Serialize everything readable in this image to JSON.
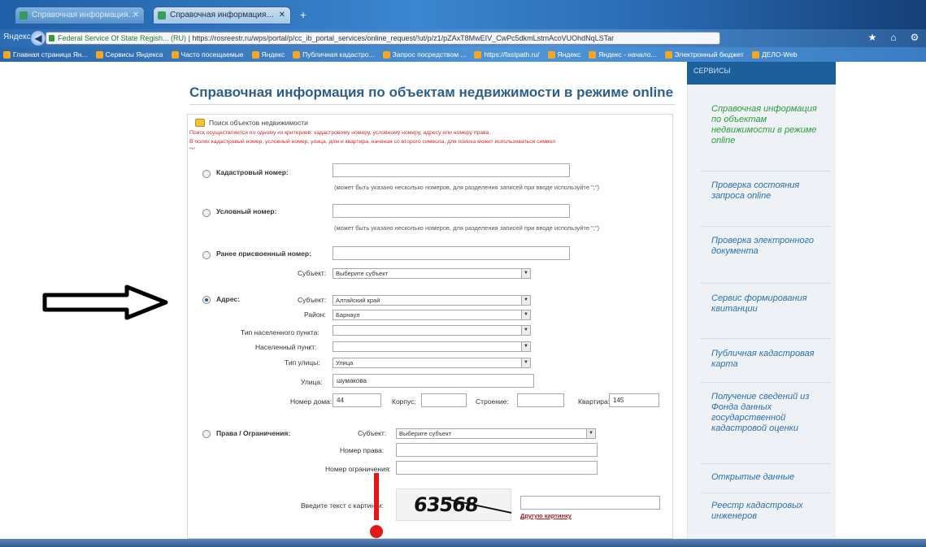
{
  "browser": {
    "tabs": [
      {
        "label": "Справочная информация…"
      },
      {
        "label": "Справочная информация…"
      }
    ],
    "new_tab": "+",
    "search_label": "Яндекс",
    "url_org": "Federal Service Of State Regish... (RU)",
    "url": "https://rosreestr.ru/wps/portal/p/cc_ib_portal_services/online_request/!ut/p/z1/pZAxT8MwEIV_CwPc5dkmLstmAcoVUOhdNqLSTar",
    "toolbar_icons": [
      "★",
      "⌂",
      "⚙"
    ],
    "bookmarks": [
      "Главная страница Ян...",
      "Сервисы Яндекса",
      "Часто посещаемые",
      "Яндекс",
      "Публичная кадастро...",
      "Запрос посредством ...",
      "https://fastpath.ru/",
      "Яндекс",
      "Яндекс - начало...",
      "Электронный бюджет",
      "ДЕЛО-Web"
    ]
  },
  "page": {
    "title": "Справочная информация по объектам недвижимости в режиме online",
    "legend": "Поиск объектов недвижимости",
    "warning_lines": [
      "Поиск осуществляется по одному из критериев: кадастровому номеру, условному номеру, адресу или номеру права.",
      "В полях кадастровый номер, условный номер, улица, дом и квартира, начиная со второго символа, для поиска может использоваться символ",
      "\"*\""
    ],
    "cadastral_label": "Кадастровый номер:",
    "cadastral_hint": "(может быть указано несколько номеров, для разделения записей при вводе используйте \";\")",
    "conditional_label": "Условный номер:",
    "conditional_hint": "(может быть указано несколько номеров, для разделения записей при вводе используйте \";\")",
    "previous_label": "Ранее присвоенный номер:",
    "subject_label": "Субъект:",
    "subject_placeholder": "Выберите субъект",
    "address_label": "Адрес:",
    "address": {
      "subject_label": "Субъект:",
      "subject_value": "Алтайский край",
      "district_label": "Район:",
      "district_value": "Барнаул",
      "settlement_type_label": "Тип населенного пункта:",
      "settlement_type_value": "",
      "settlement_label": "Населенный пункт:",
      "settlement_value": "",
      "street_type_label": "Тип улицы:",
      "street_type_value": "Улица",
      "street_label": "Улица:",
      "street_value": "шумакова",
      "house_label": "Номер дома:",
      "house_value": "44",
      "korpus_label": "Корпус:",
      "korpus_value": "",
      "building_label": "Строение:",
      "building_value": "",
      "apartment_label": "Квартира:",
      "apartment_value": "145"
    },
    "rights_label": "Права / Ограничения:",
    "rights_subject_label": "Субъект:",
    "rights_subject_placeholder": "Выберите субъект",
    "right_number_label": "Номер права:",
    "restriction_number_label": "Номер ограничения:",
    "captcha_prompt": "Введите текст с картинки:",
    "captcha_text": "63568",
    "captcha_other": "Другую картинку"
  },
  "sidebar": {
    "header": "СЕРВИСЫ",
    "items": [
      "Справочная информация по объектам недвижимости в режиме online",
      "Проверка состояния запроса online",
      "Проверка электронного документа",
      "Сервис формирования квитанции",
      "Публичная кадастровая карта",
      "Получение сведений из Фонда данных государственной кадастровой оценки",
      "Открытые данные",
      "Реестр кадастровых инженеров"
    ]
  }
}
